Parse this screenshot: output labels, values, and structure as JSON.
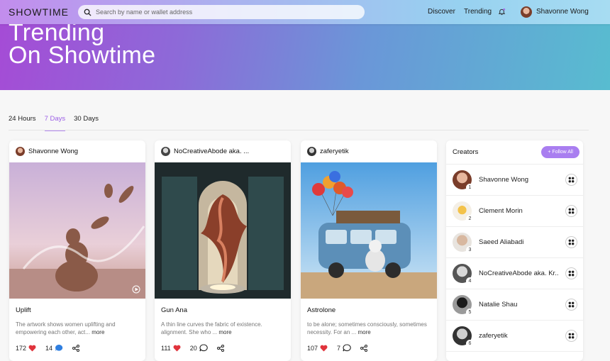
{
  "header": {
    "logo": "SHOWTIME",
    "search_placeholder": "Search by name or wallet address",
    "nav": [
      "Discover",
      "Trending"
    ],
    "user_name": "Shavonne Wong"
  },
  "hero": {
    "line1": "Trending",
    "line2": "On Showtime"
  },
  "tabs": [
    {
      "label": "24 Hours",
      "active": false
    },
    {
      "label": "7 Days",
      "active": true
    },
    {
      "label": "30 Days",
      "active": false
    }
  ],
  "cards": [
    {
      "creator": "Shavonne Wong",
      "title": "Uplift",
      "desc": "The artwork shows women uplifting and empowering each other, act...",
      "more": "more",
      "likes": "172",
      "comments": "14"
    },
    {
      "creator": "NoCreativeAbode aka. ...",
      "title": "Gun Ana",
      "desc": "A thin line curves the fabric of existence. alignment. She who ...",
      "more": "more",
      "likes": "111",
      "comments": "20"
    },
    {
      "creator": "zaferyetik",
      "title": "Astrolone",
      "desc": "to be alone; sometimes consciously, sometimes necessity. For an ...",
      "more": "more",
      "likes": "107",
      "comments": "7"
    }
  ],
  "creators": {
    "title": "Creators",
    "follow_all": "+ Follow All",
    "list": [
      {
        "rank": "1",
        "name": "Shavonne Wong"
      },
      {
        "rank": "2",
        "name": "Clement Morin"
      },
      {
        "rank": "3",
        "name": "Saeed Aliabadi"
      },
      {
        "rank": "4",
        "name": "NoCreativeAbode aka. Kr..."
      },
      {
        "rank": "5",
        "name": "Natalie Shau"
      },
      {
        "rank": "6",
        "name": "zaferyetik"
      }
    ]
  },
  "colors": {
    "accent": "#a97ef0",
    "active_tab": "#9c5fe6",
    "like": "#e0333c",
    "comment_liked": "#2f7fe0"
  }
}
